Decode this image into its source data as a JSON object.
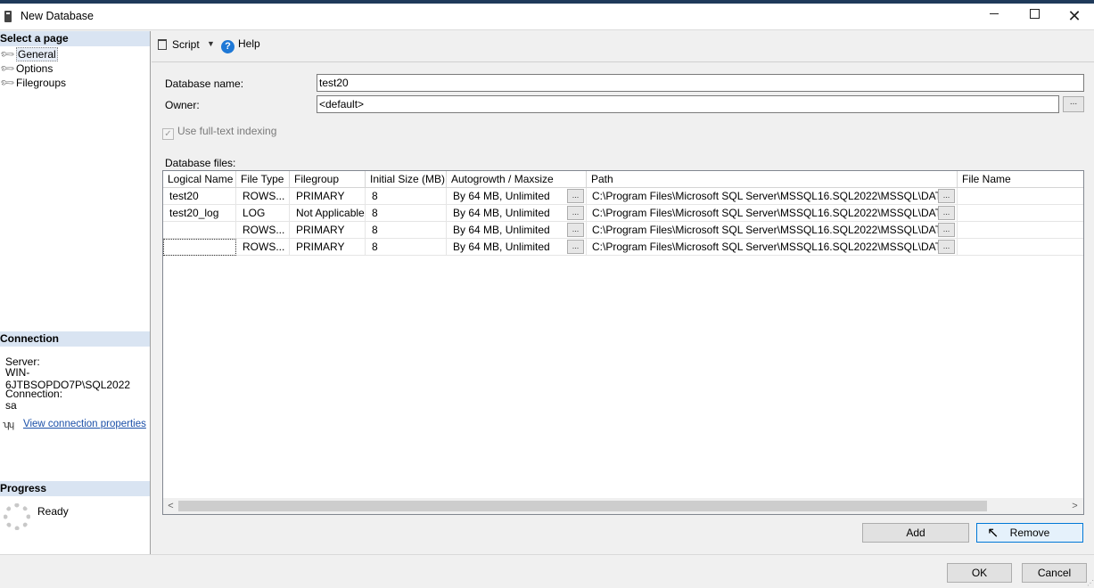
{
  "window": {
    "title": "New Database",
    "controls": {
      "minimize": "minimize",
      "maximize": "maximize",
      "close": "✕"
    }
  },
  "sidebar": {
    "select_page_header": "Select a page",
    "pages": [
      {
        "label": "General",
        "selected": true
      },
      {
        "label": "Options",
        "selected": false
      },
      {
        "label": "Filegroups",
        "selected": false
      }
    ],
    "connection_header": "Connection",
    "server_label": "Server:",
    "server_value": "WIN-6JTBSOPDO7P\\SQL2022",
    "connection_label": "Connection:",
    "connection_value": "sa",
    "view_connection_link": "View connection properties",
    "progress_header": "Progress",
    "progress_status": "Ready"
  },
  "toolbar": {
    "script_label": "Script",
    "help_label": "Help"
  },
  "form": {
    "database_name_label": "Database name:",
    "database_name_value": "test20",
    "owner_label": "Owner:",
    "owner_value": "<default>",
    "browse_button": "...",
    "fulltext_label": "Use full-text indexing",
    "fulltext_checked": true,
    "fulltext_enabled": false,
    "database_files_label": "Database files:"
  },
  "files_grid": {
    "columns": [
      "Logical Name",
      "File Type",
      "Filegroup",
      "Initial Size (MB)",
      "Autogrowth / Maxsize",
      "Path",
      "File Name"
    ],
    "rows": [
      {
        "logical_name": "test20",
        "file_type": "ROWS...",
        "filegroup": "PRIMARY",
        "initial_size": "8",
        "autogrowth": "By 64 MB, Unlimited",
        "path": "C:\\Program Files\\Microsoft SQL Server\\MSSQL16.SQL2022\\MSSQL\\DATA\\",
        "file_name": ""
      },
      {
        "logical_name": "test20_log",
        "file_type": "LOG",
        "filegroup": "Not Applicable",
        "initial_size": "8",
        "autogrowth": "By 64 MB, Unlimited",
        "path": "C:\\Program Files\\Microsoft SQL Server\\MSSQL16.SQL2022\\MSSQL\\DATA\\",
        "file_name": ""
      },
      {
        "logical_name": "",
        "file_type": "ROWS...",
        "filegroup": "PRIMARY",
        "initial_size": "8",
        "autogrowth": "By 64 MB, Unlimited",
        "path": "C:\\Program Files\\Microsoft SQL Server\\MSSQL16.SQL2022\\MSSQL\\DATA\\",
        "file_name": ""
      },
      {
        "logical_name": "",
        "file_type": "ROWS...",
        "filegroup": "PRIMARY",
        "initial_size": "8",
        "autogrowth": "By 64 MB, Unlimited",
        "path": "C:\\Program Files\\Microsoft SQL Server\\MSSQL16.SQL2022\\MSSQL\\DATA\\",
        "file_name": ""
      }
    ],
    "cell_button": "...",
    "scroll_left": "<",
    "scroll_right": ">"
  },
  "buttons": {
    "add": "Add",
    "remove": "Remove",
    "ok": "OK",
    "cancel": "Cancel"
  },
  "colors": {
    "section_header_bg": "#d9e4f2",
    "link": "#1a4fa8",
    "accent": "#0078d7"
  }
}
